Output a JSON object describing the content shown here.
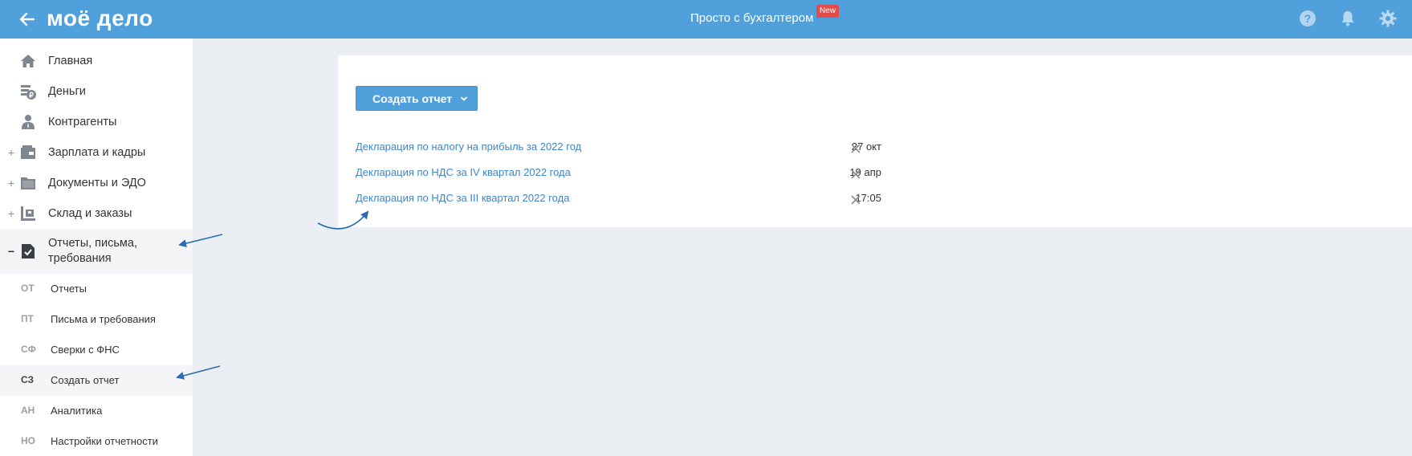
{
  "header": {
    "logo": "моё дело",
    "promo_text": "Просто с бухгалтером",
    "promo_badge": "New",
    "icons": [
      "back-arrow-icon",
      "help-icon",
      "bell-icon",
      "gear-icon"
    ],
    "accent_color": "#50a0dc",
    "badge_color": "#e44b4b"
  },
  "sidebar": {
    "items": [
      {
        "label": "Главная",
        "icon": "home-icon",
        "toggle": ""
      },
      {
        "label": "Деньги",
        "icon": "money-icon",
        "toggle": ""
      },
      {
        "label": "Контрагенты",
        "icon": "person-icon",
        "toggle": ""
      },
      {
        "label": "Зарплата и кадры",
        "icon": "wallet-icon",
        "toggle": "+"
      },
      {
        "label": "Документы и ЭДО",
        "icon": "folder-icon",
        "toggle": "+"
      },
      {
        "label": "Склад и заказы",
        "icon": "warehouse-icon",
        "toggle": "+"
      },
      {
        "label": "Отчеты, письма,",
        "label2": "требования",
        "icon": "report-icon",
        "toggle": "−"
      }
    ],
    "sub_items": [
      {
        "abbr": "ОТ",
        "label": "Отчеты"
      },
      {
        "abbr": "ПТ",
        "label": "Письма и требования"
      },
      {
        "abbr": "СФ",
        "label": "Сверки с ФНС"
      },
      {
        "abbr": "СЗ",
        "label": "Создать отчет"
      },
      {
        "abbr": "АН",
        "label": "Аналитика"
      },
      {
        "abbr": "НО",
        "label": "Настройки отчетности"
      }
    ]
  },
  "main": {
    "create_button": "Создать отчет",
    "reports": [
      {
        "title": "Декларация по налогу на прибыль за 2022 год",
        "date": "27 окт"
      },
      {
        "title": "Декларация по НДС за IV квартал 2022 года",
        "date": "19 апр"
      },
      {
        "title": "Декларация по НДС за III квартал 2022 года",
        "date": "17:05"
      }
    ],
    "link_color": "#3e86c7",
    "annotation_color": "#2a6cb5"
  }
}
